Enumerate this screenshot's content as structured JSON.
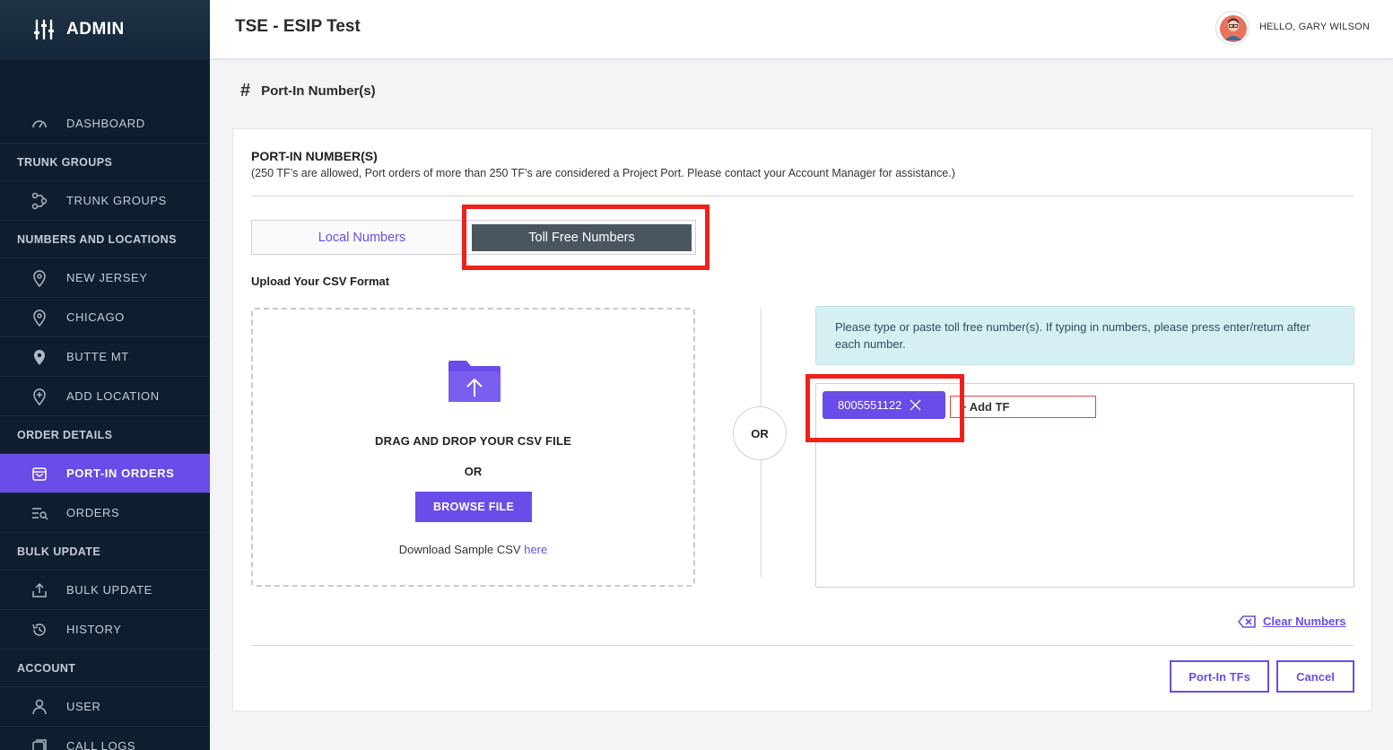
{
  "sidebar": {
    "brand": "ADMIN",
    "items": [
      {
        "type": "item",
        "label": "DASHBOARD",
        "icon": "dashboard-icon",
        "active": false
      },
      {
        "type": "section",
        "label": "TRUNK GROUPS"
      },
      {
        "type": "item",
        "label": "TRUNK GROUPS",
        "icon": "trunk-groups-icon",
        "active": false
      },
      {
        "type": "section",
        "label": "NUMBERS AND LOCATIONS"
      },
      {
        "type": "item",
        "label": "NEW JERSEY",
        "icon": "location-pin-icon",
        "active": false
      },
      {
        "type": "item",
        "label": "CHICAGO",
        "icon": "location-pin-icon",
        "active": false
      },
      {
        "type": "item",
        "label": "BUTTE MT",
        "icon": "location-pin-filled-icon",
        "active": false
      },
      {
        "type": "item",
        "label": "ADD LOCATION",
        "icon": "add-location-icon",
        "active": false
      },
      {
        "type": "section",
        "label": "ORDER DETAILS"
      },
      {
        "type": "item",
        "label": "PORT-IN ORDERS",
        "icon": "port-in-icon",
        "active": true
      },
      {
        "type": "item",
        "label": "ORDERS",
        "icon": "orders-icon",
        "active": false
      },
      {
        "type": "section",
        "label": "BULK UPDATE"
      },
      {
        "type": "item",
        "label": "BULK UPDATE",
        "icon": "upload-icon",
        "active": false
      },
      {
        "type": "item",
        "label": "HISTORY",
        "icon": "history-icon",
        "active": false
      },
      {
        "type": "section",
        "label": "ACCOUNT"
      },
      {
        "type": "item",
        "label": "USER",
        "icon": "user-icon",
        "active": false
      },
      {
        "type": "item",
        "label": "CALL LOGS",
        "icon": "call-logs-icon",
        "active": false
      }
    ]
  },
  "header": {
    "title": "TSE - ESIP Test",
    "greeting": "HELLO, GARY WILSON"
  },
  "page": {
    "hash": "#",
    "title": "Port-In Number(s)"
  },
  "card": {
    "title": "PORT-IN NUMBER(S)",
    "subtitle": "(250 TF’s are allowed, Port orders of more than 250 TF’s are considered a Project Port. Please contact your Account Manager for assistance.)",
    "tabs": {
      "local": "Local Numbers",
      "tollfree": "Toll Free Numbers",
      "active": "tollfree"
    },
    "upload_label": "Upload Your CSV Format",
    "dropzone": {
      "drag_text": "DRAG AND DROP YOUR CSV FILE",
      "or_text": "OR",
      "browse_label": "BROWSE FILE",
      "sample_text": "Download Sample CSV ",
      "sample_link": "here"
    },
    "or_divider": "OR",
    "info_text": "Please type or paste toll free number(s). If typing in numbers, please press enter/return after each number.",
    "chips": [
      "8005551122"
    ],
    "add_tf_placeholder": "+ Add TF",
    "clear_label": "Clear Numbers",
    "buttons": {
      "port_in": "Port-In TFs",
      "cancel": "Cancel"
    }
  },
  "colors": {
    "accent": "#6a4ce8",
    "sidebar_bg": "#0f1e2e",
    "highlight": "#f0211c",
    "tab_active_bg": "#4b5560"
  }
}
